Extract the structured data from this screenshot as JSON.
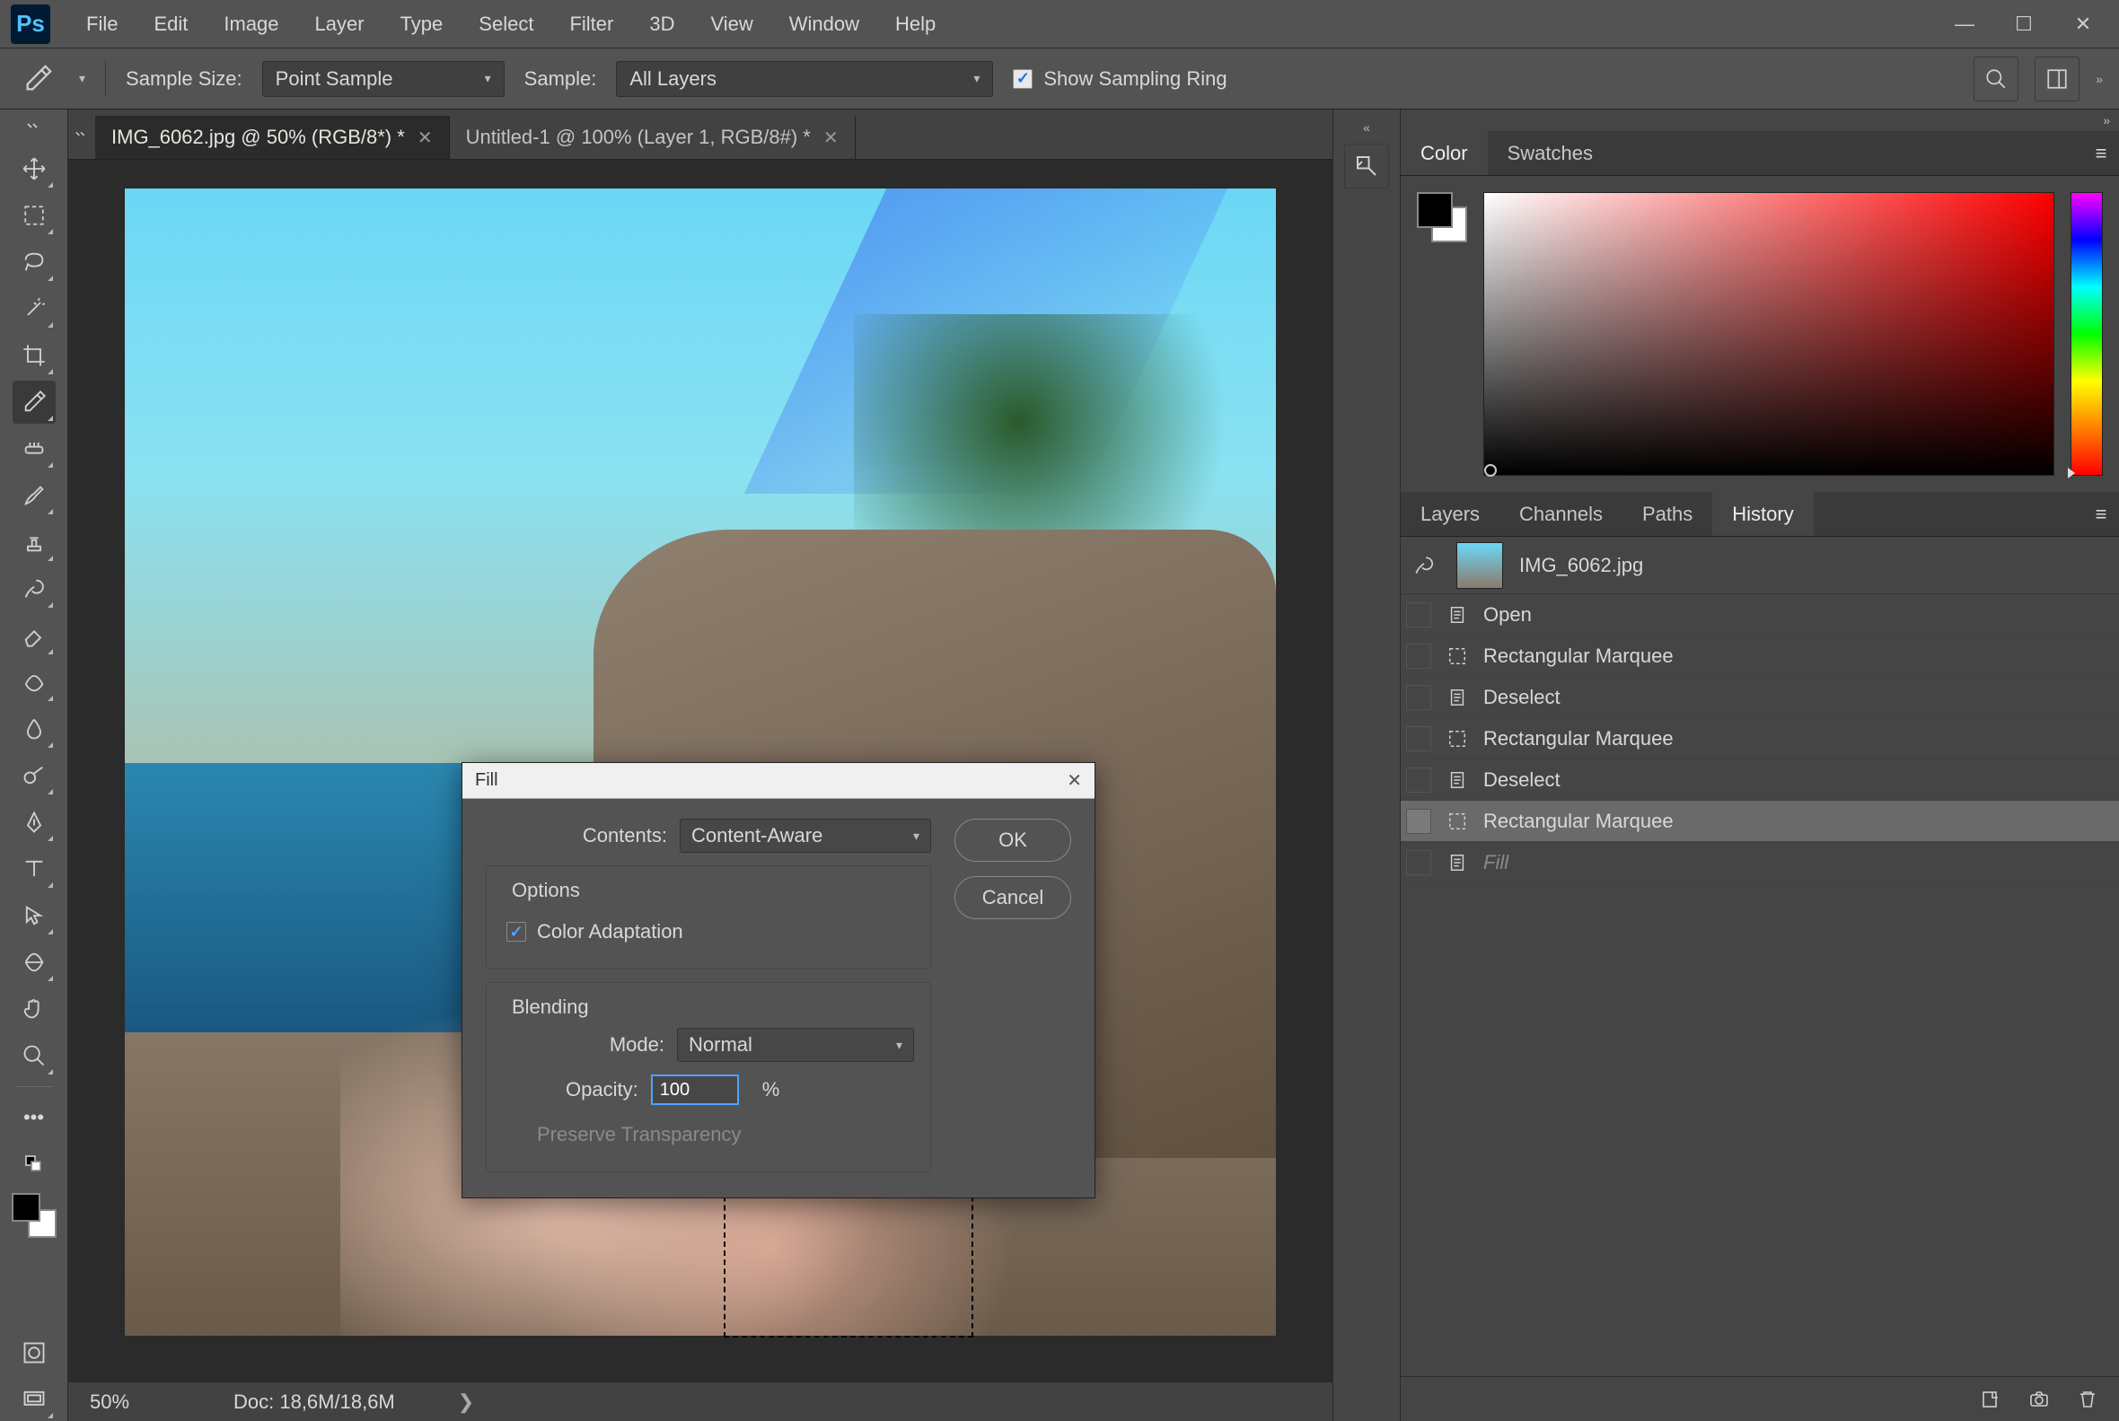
{
  "menu": {
    "items": [
      "File",
      "Edit",
      "Image",
      "Layer",
      "Type",
      "Select",
      "Filter",
      "3D",
      "View",
      "Window",
      "Help"
    ]
  },
  "options": {
    "sample_size_label": "Sample Size:",
    "sample_size_value": "Point Sample",
    "sample_label": "Sample:",
    "sample_value": "All Layers",
    "show_ring": "Show Sampling Ring"
  },
  "tabs": [
    {
      "label": "IMG_6062.jpg @ 50% (RGB/8*) *",
      "active": true
    },
    {
      "label": "Untitled-1 @ 100% (Layer 1, RGB/8#) *",
      "active": false
    }
  ],
  "status": {
    "zoom": "50%",
    "doc": "Doc: 18,6M/18,6M"
  },
  "color_panel": {
    "tabs": [
      "Color",
      "Swatches"
    ]
  },
  "layers_panel": {
    "tabs": [
      "Layers",
      "Channels",
      "Paths",
      "History"
    ],
    "active_index": 3
  },
  "history": {
    "source": "IMG_6062.jpg",
    "items": [
      {
        "label": "Open",
        "icon": "doc"
      },
      {
        "label": "Rectangular Marquee",
        "icon": "marquee"
      },
      {
        "label": "Deselect",
        "icon": "doc"
      },
      {
        "label": "Rectangular Marquee",
        "icon": "marquee"
      },
      {
        "label": "Deselect",
        "icon": "doc"
      },
      {
        "label": "Rectangular Marquee",
        "icon": "marquee",
        "selected": true
      },
      {
        "label": "Fill",
        "icon": "doc",
        "future": true
      }
    ]
  },
  "dialog": {
    "title": "Fill",
    "contents_label": "Contents:",
    "contents_value": "Content-Aware",
    "options_label": "Options",
    "color_adapt": "Color Adaptation",
    "blending_label": "Blending",
    "mode_label": "Mode:",
    "mode_value": "Normal",
    "opacity_label": "Opacity:",
    "opacity_value": "100",
    "opacity_pct": "%",
    "preserve_label": "Preserve Transparency",
    "ok": "OK",
    "cancel": "Cancel"
  }
}
